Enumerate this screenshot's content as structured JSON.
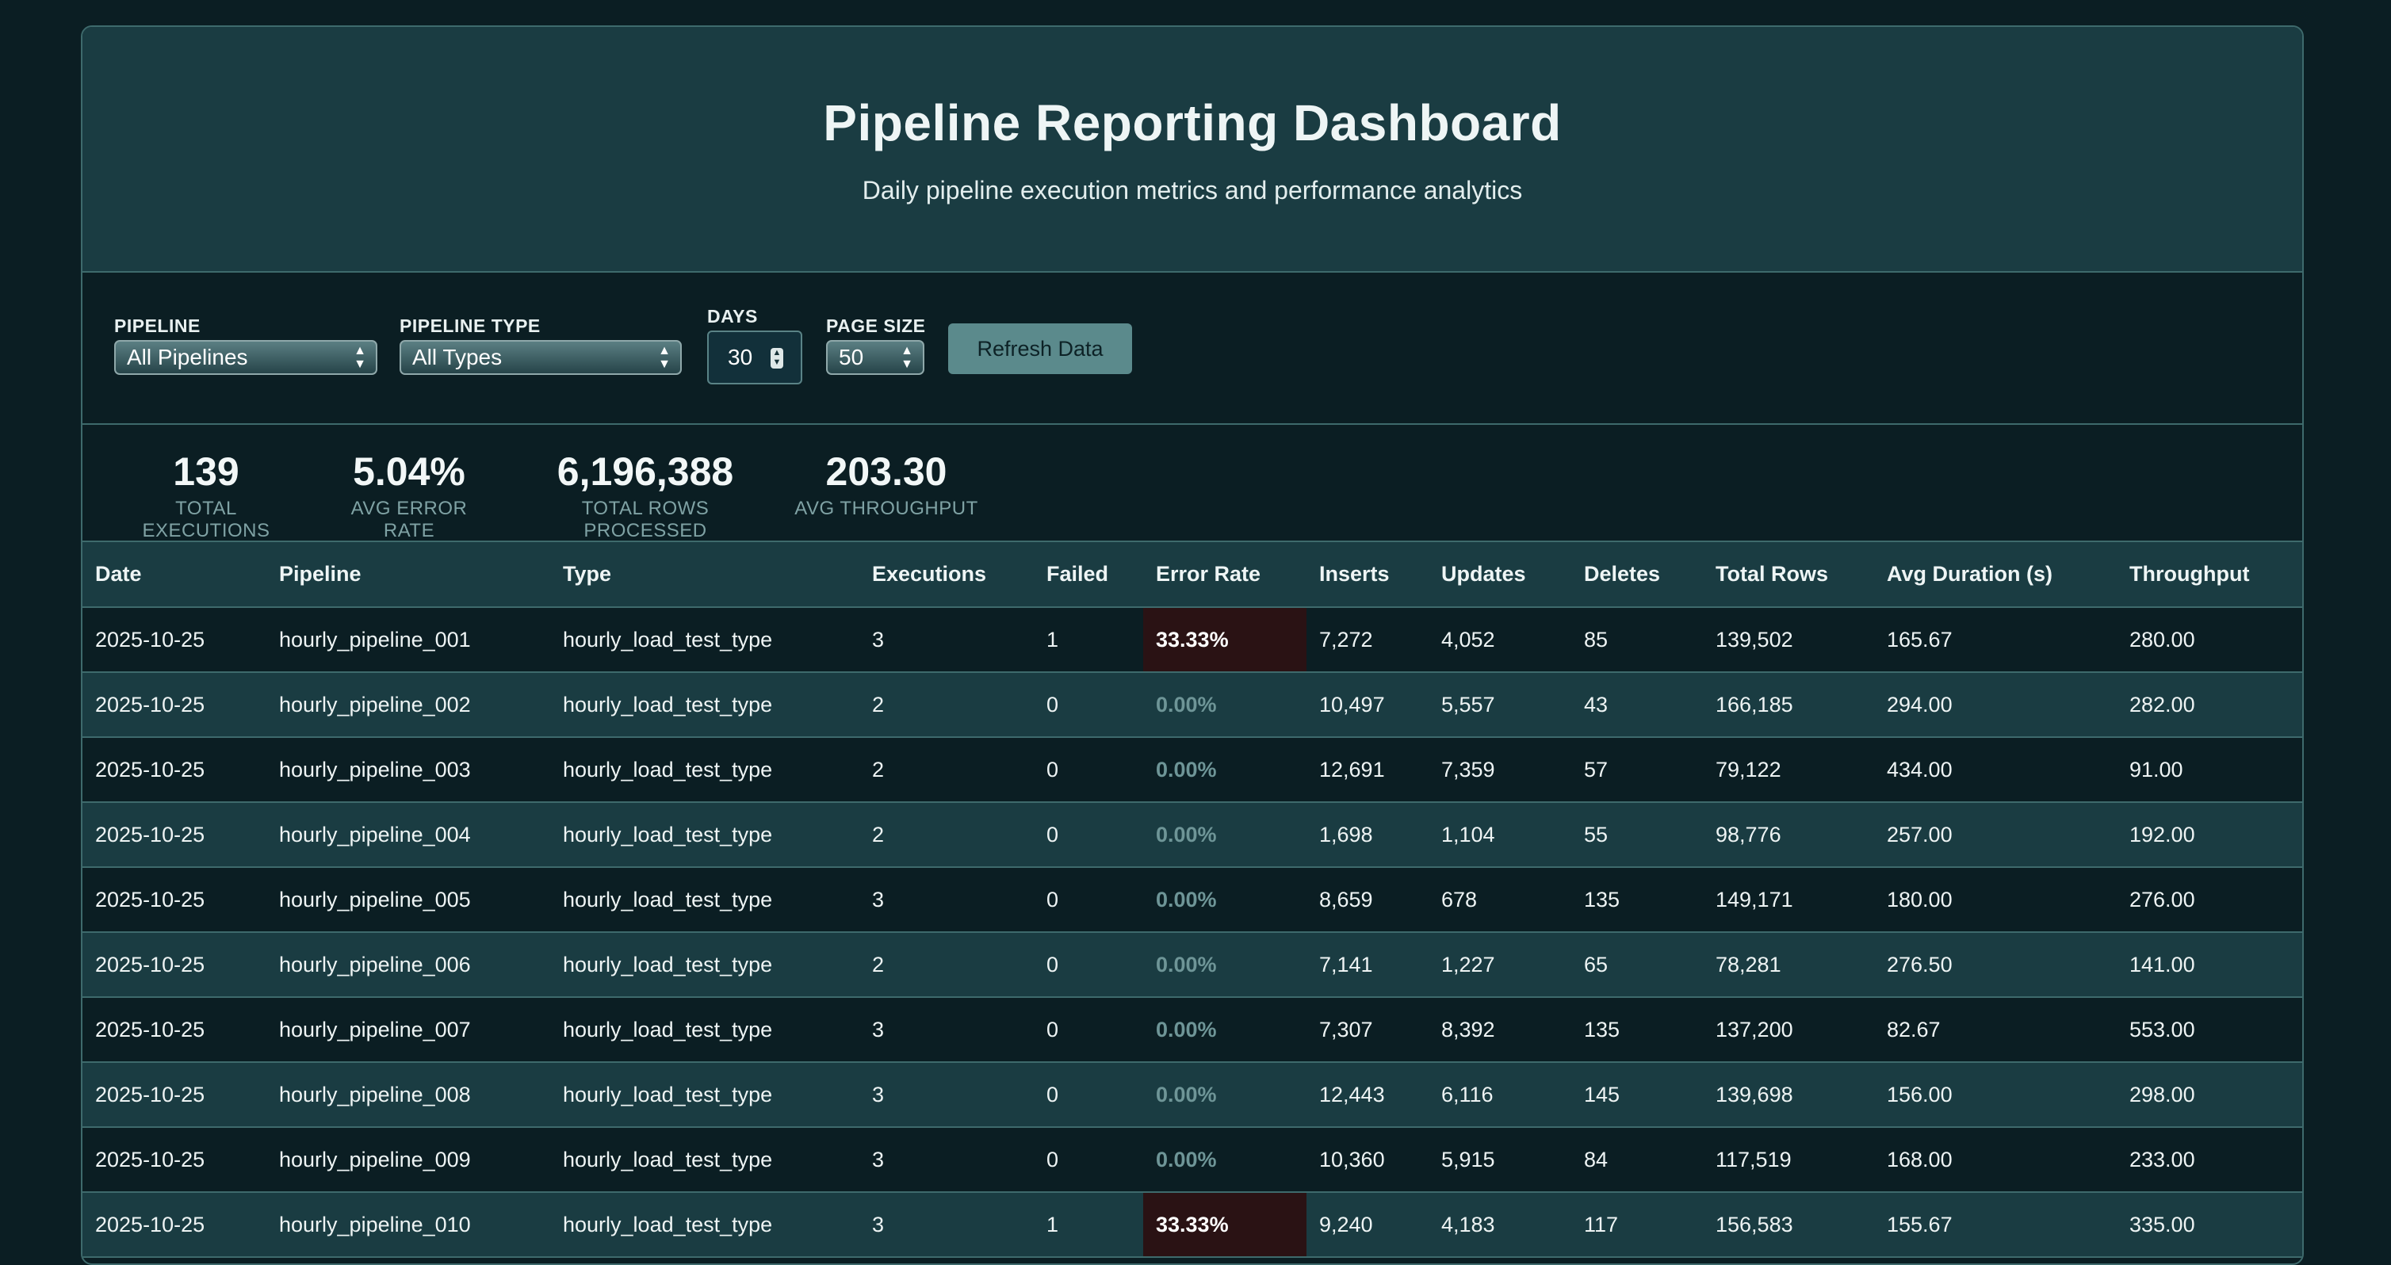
{
  "header": {
    "title": "Pipeline Reporting Dashboard",
    "subtitle": "Daily pipeline execution metrics and performance analytics"
  },
  "filters": {
    "pipeline": {
      "label": "PIPELINE",
      "value": "All Pipelines"
    },
    "pipeline_type": {
      "label": "PIPELINE TYPE",
      "value": "All Types"
    },
    "days": {
      "label": "DAYS",
      "value": "30"
    },
    "page_size": {
      "label": "PAGE SIZE",
      "value": "50"
    },
    "refresh_label": "Refresh Data"
  },
  "stats": [
    {
      "value": "139",
      "label": "TOTAL EXECUTIONS"
    },
    {
      "value": "5.04%",
      "label": "AVG ERROR RATE"
    },
    {
      "value": "6,196,388",
      "label": "TOTAL ROWS PROCESSED"
    },
    {
      "value": "203.30",
      "label": "AVG THROUGHPUT"
    }
  ],
  "table": {
    "columns": [
      "Date",
      "Pipeline",
      "Type",
      "Executions",
      "Failed",
      "Error Rate",
      "Inserts",
      "Updates",
      "Deletes",
      "Total Rows",
      "Avg Duration (s)",
      "Throughput"
    ],
    "rows": [
      [
        "2025-10-25",
        "hourly_pipeline_001",
        "hourly_load_test_type",
        "3",
        "1",
        "33.33%",
        "7,272",
        "4,052",
        "85",
        "139,502",
        "165.67",
        "280.00"
      ],
      [
        "2025-10-25",
        "hourly_pipeline_002",
        "hourly_load_test_type",
        "2",
        "0",
        "0.00%",
        "10,497",
        "5,557",
        "43",
        "166,185",
        "294.00",
        "282.00"
      ],
      [
        "2025-10-25",
        "hourly_pipeline_003",
        "hourly_load_test_type",
        "2",
        "0",
        "0.00%",
        "12,691",
        "7,359",
        "57",
        "79,122",
        "434.00",
        "91.00"
      ],
      [
        "2025-10-25",
        "hourly_pipeline_004",
        "hourly_load_test_type",
        "2",
        "0",
        "0.00%",
        "1,698",
        "1,104",
        "55",
        "98,776",
        "257.00",
        "192.00"
      ],
      [
        "2025-10-25",
        "hourly_pipeline_005",
        "hourly_load_test_type",
        "3",
        "0",
        "0.00%",
        "8,659",
        "678",
        "135",
        "149,171",
        "180.00",
        "276.00"
      ],
      [
        "2025-10-25",
        "hourly_pipeline_006",
        "hourly_load_test_type",
        "2",
        "0",
        "0.00%",
        "7,141",
        "1,227",
        "65",
        "78,281",
        "276.50",
        "141.00"
      ],
      [
        "2025-10-25",
        "hourly_pipeline_007",
        "hourly_load_test_type",
        "3",
        "0",
        "0.00%",
        "7,307",
        "8,392",
        "135",
        "137,200",
        "82.67",
        "553.00"
      ],
      [
        "2025-10-25",
        "hourly_pipeline_008",
        "hourly_load_test_type",
        "3",
        "0",
        "0.00%",
        "12,443",
        "6,116",
        "145",
        "139,698",
        "156.00",
        "298.00"
      ],
      [
        "2025-10-25",
        "hourly_pipeline_009",
        "hourly_load_test_type",
        "3",
        "0",
        "0.00%",
        "10,360",
        "5,915",
        "84",
        "117,519",
        "168.00",
        "233.00"
      ],
      [
        "2025-10-25",
        "hourly_pipeline_010",
        "hourly_load_test_type",
        "3",
        "1",
        "33.33%",
        "9,240",
        "4,183",
        "117",
        "156,583",
        "155.67",
        "335.00"
      ]
    ]
  },
  "colors": {
    "background": "#0b1e23",
    "panel_header": "#1a3c42",
    "border": "#3e6a6c",
    "error_highlight": "#2a1214",
    "muted_text": "#7fa2a4",
    "button": "#5b8a8c"
  }
}
